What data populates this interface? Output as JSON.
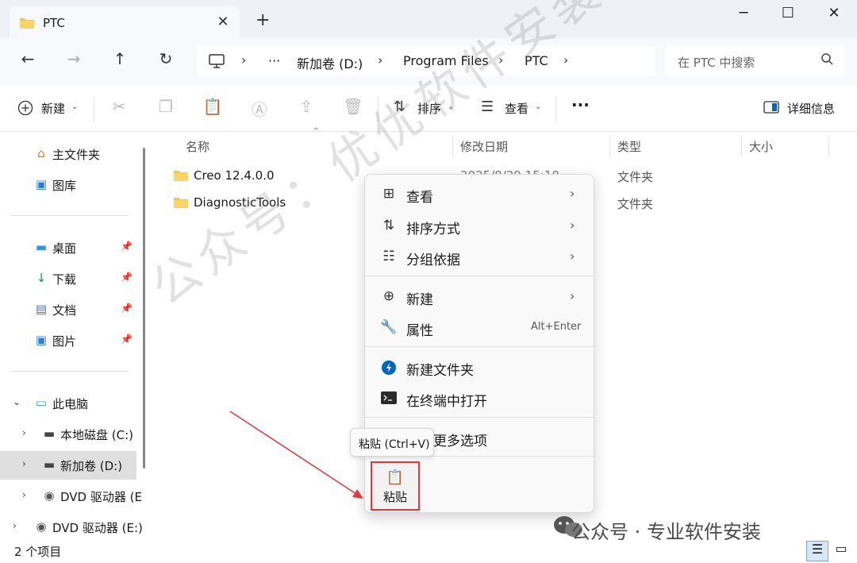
{
  "window": {
    "tab_title": "PTC",
    "tab_close": "✕",
    "new_tab": "+",
    "minimize": "─",
    "maximize": "☐",
    "close": "✕"
  },
  "nav": {
    "back": "←",
    "forward": "→",
    "up": "↑",
    "refresh": "↻",
    "breadcrumb": [
      "新加卷 (D:)",
      "Program Files",
      "PTC"
    ],
    "more": "···",
    "search_placeholder": "在 PTC 中搜索"
  },
  "toolbar": {
    "new_label": "新建",
    "sort_label": "排序",
    "view_label": "查看",
    "more_label": "···",
    "details_label": "详细信息"
  },
  "sidebar": {
    "items": [
      {
        "label": "主文件夹",
        "icon": "home-icon"
      },
      {
        "label": "图库",
        "icon": "gallery-icon"
      },
      {
        "label": "桌面",
        "icon": "desktop-icon",
        "pinned": true
      },
      {
        "label": "下载",
        "icon": "download-icon",
        "pinned": true
      },
      {
        "label": "文档",
        "icon": "documents-icon",
        "pinned": true
      },
      {
        "label": "图片",
        "icon": "pictures-icon",
        "pinned": true
      },
      {
        "label": "此电脑",
        "icon": "computer-icon",
        "expanded": true
      },
      {
        "label": "本地磁盘 (C:)",
        "icon": "drive-icon"
      },
      {
        "label": "新加卷 (D:)",
        "icon": "drive-icon",
        "selected": true
      },
      {
        "label": "DVD 驱动器 (E",
        "icon": "dvd-icon"
      },
      {
        "label": "DVD 驱动器 (E:)",
        "icon": "dvd-icon"
      }
    ]
  },
  "columns": {
    "name": "名称",
    "modified": "修改日期",
    "type": "类型",
    "size": "大小"
  },
  "files": [
    {
      "name": "Creo 12.4.0.0",
      "date": "2025/8/29 15:10",
      "type": "文件夹"
    },
    {
      "name": "DiagnosticTools",
      "date": "",
      "type": "文件夹"
    }
  ],
  "context_menu": {
    "items": [
      {
        "label": "查看",
        "icon": "grid-icon",
        "arrow": true
      },
      {
        "label": "排序方式",
        "icon": "sort-icon",
        "arrow": true
      },
      {
        "label": "分组依据",
        "icon": "group-icon",
        "arrow": true
      },
      {
        "label": "新建",
        "icon": "add-icon",
        "arrow": true
      },
      {
        "label": "属性",
        "icon": "wrench-icon",
        "shortcut": "Alt+Enter"
      },
      {
        "label": "新建文件夹",
        "icon": "new-folder-icon"
      },
      {
        "label": "在终端中打开",
        "icon": "terminal-icon"
      },
      {
        "label": "显示更多选项",
        "icon": "more-options-icon"
      }
    ],
    "paste_label": "粘贴",
    "tooltip": "粘贴 (Ctrl+V)"
  },
  "status": {
    "count": "2 个项目"
  },
  "watermark": {
    "diagonal": "公众号：优优软件安装",
    "footer": "公众号 · 专业软件安装"
  },
  "colors": {
    "accent": "#0067c0",
    "annotation_red": "#e0393e",
    "folder": "#f5c24a"
  }
}
